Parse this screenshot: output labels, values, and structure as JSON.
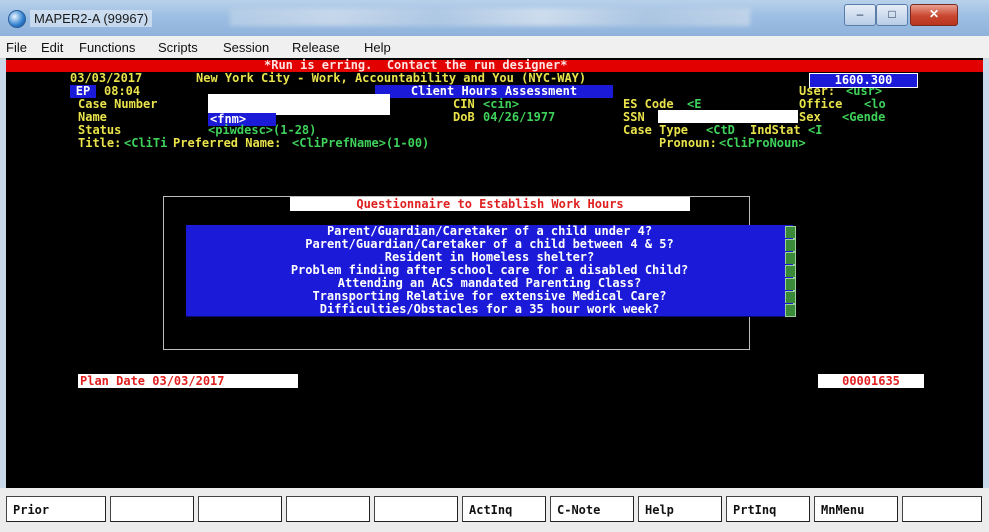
{
  "window": {
    "title": "MAPER2-A (99967)",
    "minimize_glyph": "–",
    "maximize_glyph": "□",
    "close_glyph": "✕"
  },
  "menu": [
    "File",
    "Edit",
    "Functions",
    "Scripts",
    "Session",
    "Release",
    "Help"
  ],
  "terminal": {
    "error_banner": "*Run is erring.  Contact the run designer*",
    "date": "03/03/2017",
    "banner": "New York City - Work, Accountability and You (NYC-WAY)",
    "code_box": "1600.300",
    "ep": "EP",
    "time": "08:04",
    "screen_title": "Client Hours Assessment",
    "user_label": "User:",
    "user_value": "<usr>",
    "case_number_label": "Case Number",
    "cin_label": "CIN",
    "cin_value": "<cin>",
    "es_code_label": "ES Code",
    "es_code_value": "<E",
    "office_label": "Office",
    "office_value": "<lo",
    "name_label": "Name",
    "name_value": "<fnm>",
    "dob_label": "DoB",
    "dob_value": "04/26/1977",
    "ssn_label": "SSN",
    "sex_label": "Sex",
    "sex_value": "<Gende",
    "status_label": "Status",
    "status_value": "<piwdesc>(1-28)",
    "case_type_label": "Case Type",
    "case_type_value": "<CtD",
    "indstat_label": "IndStat",
    "indstat_value": "<I",
    "title_line_label": "Title:",
    "title_value": "<CliTi",
    "preferred_label": "Preferred Name:",
    "preferred_value": "<CliPrefName>(1-00)",
    "pronoun_label": "Pronoun:",
    "pronoun_value": "<CliProNoun>",
    "questionnaire_title": "Questionnaire to Establish Work Hours",
    "questions": [
      "Parent/Guardian/Caretaker of a child under 4?",
      "Parent/Guardian/Caretaker of a child between 4 & 5?",
      "Resident in Homeless shelter?",
      "Problem finding after school care for a disabled Child?",
      "Attending an ACS mandated Parenting Class?",
      "Transporting Relative for extensive Medical Care?",
      "Difficulties/Obstacles for a 35 hour work week?"
    ],
    "plan_date": "Plan Date 03/03/2017",
    "plan_number": "00001635"
  },
  "function_keys": [
    "Prior",
    "",
    "",
    "",
    "",
    "ActInq",
    "C-Note",
    "Help",
    "PrtInq",
    "MnMenu",
    ""
  ],
  "colors": {
    "terminal_bg": "#000000",
    "label": "#e9e24a",
    "value": "#3fd25a",
    "error": "#e20000",
    "field_blue": "#1a1ad8"
  }
}
